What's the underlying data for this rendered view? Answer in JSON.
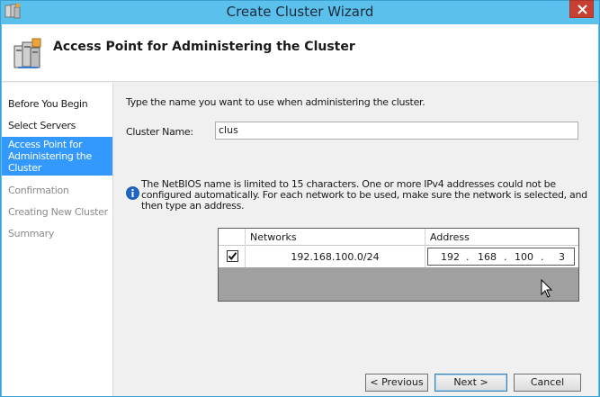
{
  "window": {
    "title": "Create Cluster Wizard",
    "accent": "#5cc0ec"
  },
  "header": {
    "title": "Access Point for Administering the Cluster",
    "icon": "cluster-servers-icon"
  },
  "sidebar": {
    "steps": [
      {
        "label": "Before You Begin",
        "state": "done"
      },
      {
        "label": "Select Servers",
        "state": "done"
      },
      {
        "label": "Access Point for Administering the Cluster",
        "state": "active"
      },
      {
        "label": "Confirmation",
        "state": "disabled"
      },
      {
        "label": "Creating New Cluster",
        "state": "disabled"
      },
      {
        "label": "Summary",
        "state": "disabled"
      }
    ],
    "active_color": "#3399ff"
  },
  "main": {
    "instruction": "Type the name you want to use when administering the cluster.",
    "cluster_name_label": "Cluster Name:",
    "cluster_name_value": "clus",
    "info_text": "The NetBIOS name is limited to 15 characters.  One or more IPv4 addresses could not be configured automatically.  For each network to be used, make sure the network is selected, and then type an address.",
    "table": {
      "headers": [
        "",
        "Networks",
        "Address"
      ],
      "rows": [
        {
          "checked": true,
          "network": "192.168.100.0/24",
          "address": [
            "192",
            "168",
            "100",
            "3"
          ]
        }
      ]
    }
  },
  "footer": {
    "previous": "< Previous",
    "next": "Next >",
    "cancel": "Cancel"
  }
}
